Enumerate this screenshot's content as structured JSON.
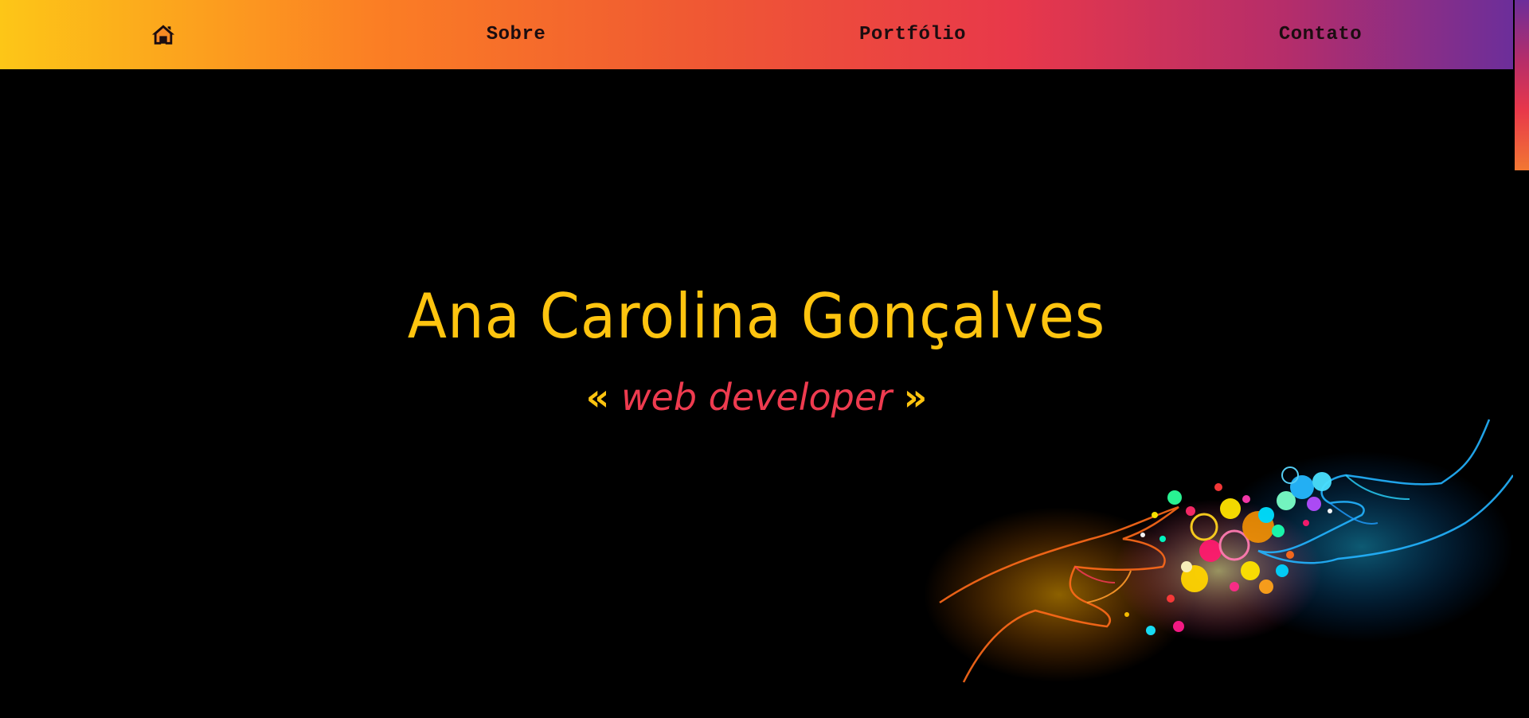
{
  "nav": {
    "home_icon": "home-icon",
    "items": [
      {
        "label": "Sobre"
      },
      {
        "label": "Portfólio"
      },
      {
        "label": "Contato"
      }
    ]
  },
  "hero": {
    "name": "Ana Carolina Gonçalves",
    "role_open": "«",
    "role": "web developer",
    "role_close": "»"
  },
  "colors": {
    "gradient_start": "#fdc617",
    "gradient_mid": "#e8384a",
    "gradient_end": "#6c2e9a",
    "name_color": "#fec40f",
    "role_color": "#ee3b4f",
    "background": "#000000"
  }
}
